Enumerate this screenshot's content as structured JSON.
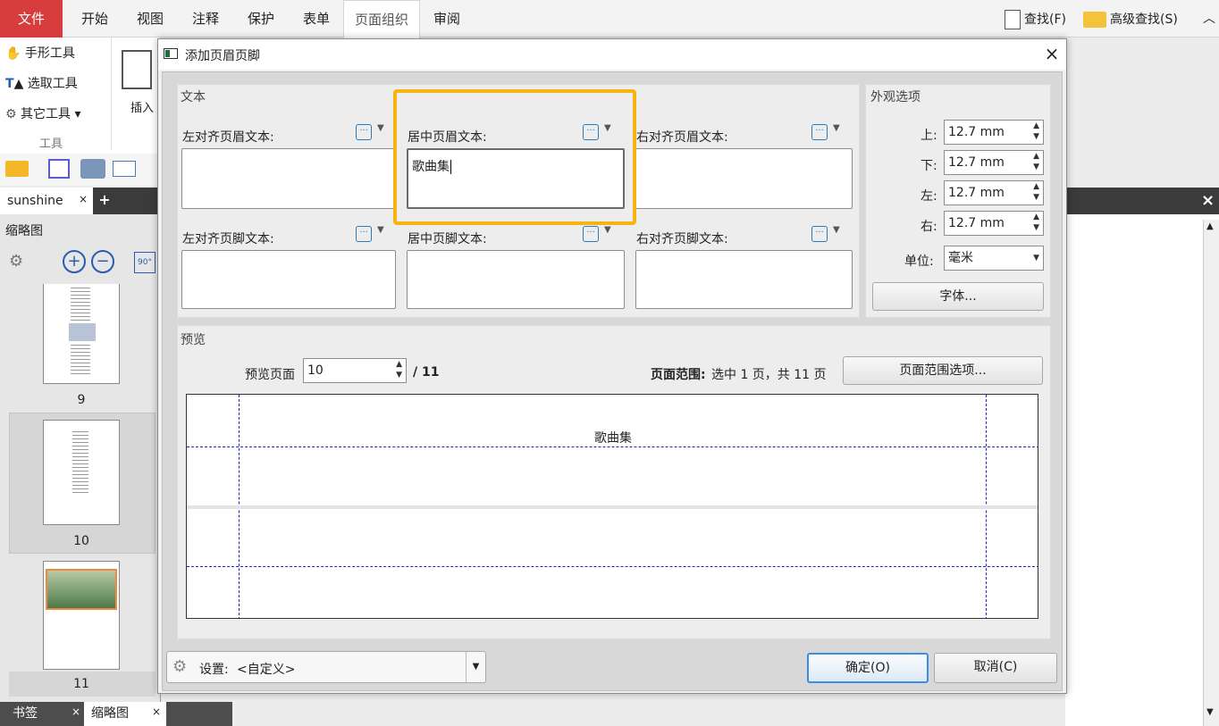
{
  "ribbon": {
    "tabs": [
      "文件",
      "开始",
      "视图",
      "注释",
      "保护",
      "表单",
      "页面组织",
      "审阅"
    ],
    "find_label": "查找(F)",
    "advanced_find_label": "高级查找(S)",
    "tools": {
      "hand": "手形工具",
      "select": "选取工具",
      "other": "其它工具",
      "group": "工具",
      "insert": "插入"
    }
  },
  "document": {
    "tab_name": "sunshine"
  },
  "thumbnails": {
    "title": "缩略图",
    "pages": [
      "9",
      "10",
      "11"
    ]
  },
  "bottom_tabs": {
    "bookmarks": "书签",
    "thumbnails": "缩略图"
  },
  "dialog": {
    "title": "添加页眉页脚",
    "text_group": "文本",
    "header_left_label": "左对齐页眉文本:",
    "header_center_label": "居中页眉文本:",
    "header_right_label": "右对齐页眉文本:",
    "footer_left_label": "左对齐页脚文本:",
    "footer_center_label": "居中页脚文本:",
    "footer_right_label": "右对齐页脚文本:",
    "header_left_value": "",
    "header_center_value": "歌曲集",
    "header_right_value": "",
    "footer_left_value": "",
    "footer_center_value": "",
    "footer_right_value": "",
    "appearance_group": "外观选项",
    "margins": {
      "top_label": "上:",
      "top_value": "12.7 mm",
      "bottom_label": "下:",
      "bottom_value": "12.7 mm",
      "left_label": "左:",
      "left_value": "12.7 mm",
      "right_label": "右:",
      "right_value": "12.7 mm"
    },
    "unit_label": "单位:",
    "unit_value": "毫米",
    "font_button": "字体...",
    "preview_group": "预览",
    "preview_page_label": "预览页面",
    "preview_page_value": "10",
    "preview_total": "/ 11",
    "page_range_label": "页面范围:",
    "page_range_text": "选中 1 页，共 11 页",
    "page_range_button": "页面范围选项...",
    "preview_header_text": "歌曲集",
    "settings_label": "设置:",
    "settings_value": "<自定义>",
    "ok_button": "确定(O)",
    "cancel_button": "取消(C)"
  },
  "colors": {
    "file_tab": "#d73d3d",
    "highlight": "#f6b40e",
    "guide": "#2323c8"
  }
}
